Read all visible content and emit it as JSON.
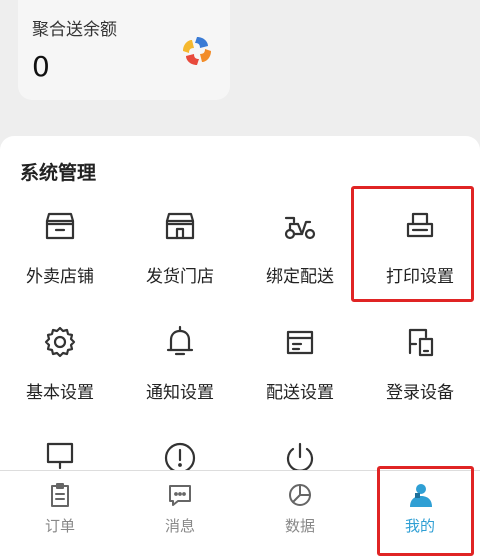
{
  "balance": {
    "label": "聚合送余额",
    "value": "0",
    "logo_icon": "aggregator-logo-icon"
  },
  "system": {
    "title": "系统管理",
    "items": [
      {
        "label": "外卖店铺",
        "icon": "storefront-icon"
      },
      {
        "label": "发货门店",
        "icon": "shop-icon"
      },
      {
        "label": "绑定配送",
        "icon": "scooter-icon"
      },
      {
        "label": "打印设置",
        "icon": "printer-icon"
      },
      {
        "label": "基本设置",
        "icon": "gear-icon"
      },
      {
        "label": "通知设置",
        "icon": "bell-icon"
      },
      {
        "label": "配送设置",
        "icon": "delivery-box-icon"
      },
      {
        "label": "登录设备",
        "icon": "devices-icon"
      },
      {
        "label": "",
        "icon": "monitor-icon"
      },
      {
        "label": "",
        "icon": "exclamation-icon"
      },
      {
        "label": "",
        "icon": "power-icon"
      }
    ]
  },
  "tabs": [
    {
      "label": "订单",
      "icon": "order-icon"
    },
    {
      "label": "消息",
      "icon": "message-icon"
    },
    {
      "label": "数据",
      "icon": "pie-chart-icon"
    },
    {
      "label": "我的",
      "icon": "user-icon",
      "active": true
    }
  ],
  "colors": {
    "accent": "#2f9fd4",
    "highlight": "#e02424",
    "icon_stroke": "#333333",
    "inactive_tab": "#888888"
  }
}
